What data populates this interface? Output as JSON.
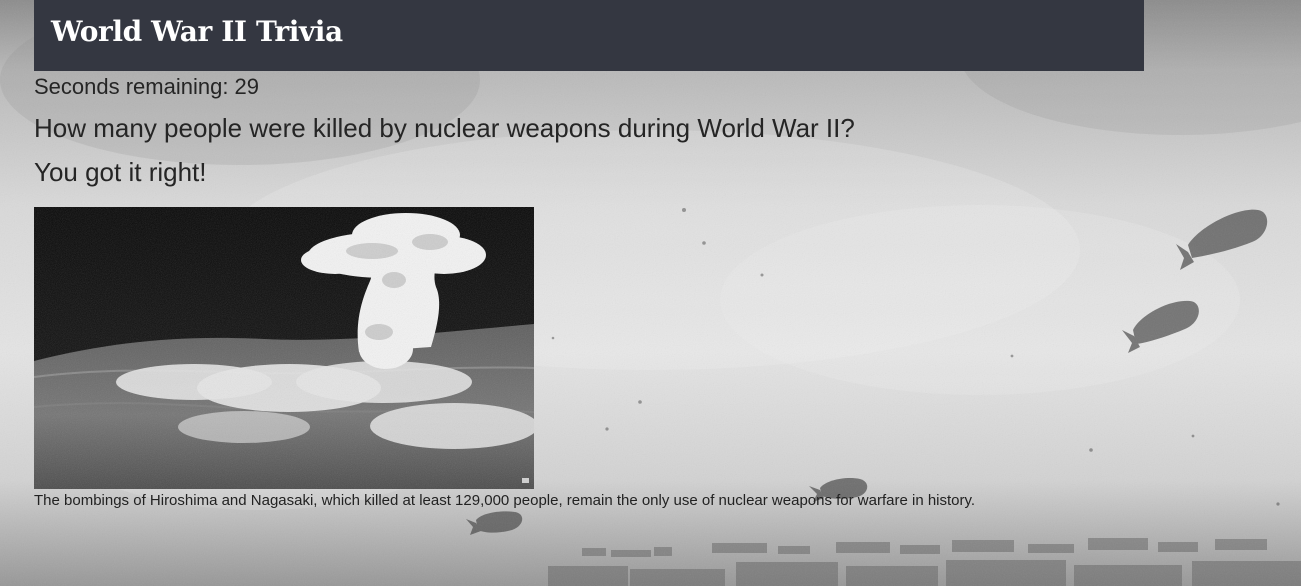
{
  "header": {
    "title": "World War II Trivia"
  },
  "quiz": {
    "timer_text": "Seconds remaining: 29",
    "question": "How many people were killed by nuclear weapons during World War II?",
    "feedback": "You got it right!",
    "image_caption": "The bombings of Hiroshima and Nagasaki, which killed at least 129,000 people, remain the only use of nuclear weapons for warfare in history."
  },
  "colors": {
    "header_background": "#343741",
    "header_text": "#ffffff",
    "body_text": "#252525"
  }
}
